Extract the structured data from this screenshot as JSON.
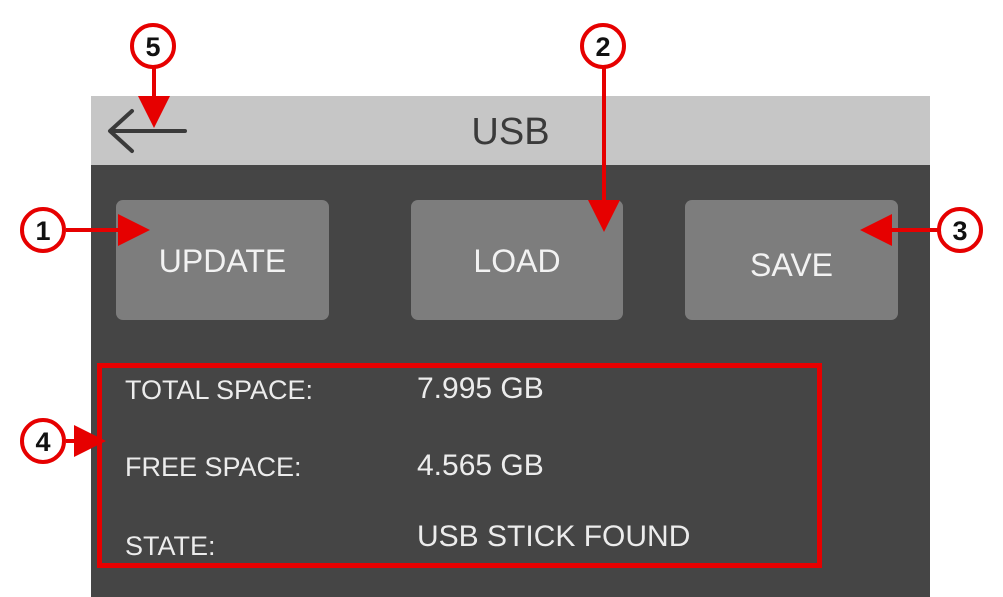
{
  "header": {
    "title": "USB",
    "back_icon": "back-arrow-icon"
  },
  "buttons": {
    "update": "UPDATE",
    "load": "LOAD",
    "save": "SAVE"
  },
  "info": {
    "total_space_label": "TOTAL SPACE:",
    "total_space_value": "7.995 GB",
    "free_space_label": "FREE SPACE:",
    "free_space_value": "4.565 GB",
    "state_label": "STATE:",
    "state_value": "USB STICK FOUND"
  },
  "annotations": {
    "callout_1": "1",
    "callout_2": "2",
    "callout_3": "3",
    "callout_4": "4",
    "callout_5": "5",
    "color": "#e60000"
  },
  "colors": {
    "header_bg": "#c6c6c6",
    "screen_bg": "#454545",
    "button_bg": "#7d7d7d",
    "text": "#f2f2f2"
  }
}
